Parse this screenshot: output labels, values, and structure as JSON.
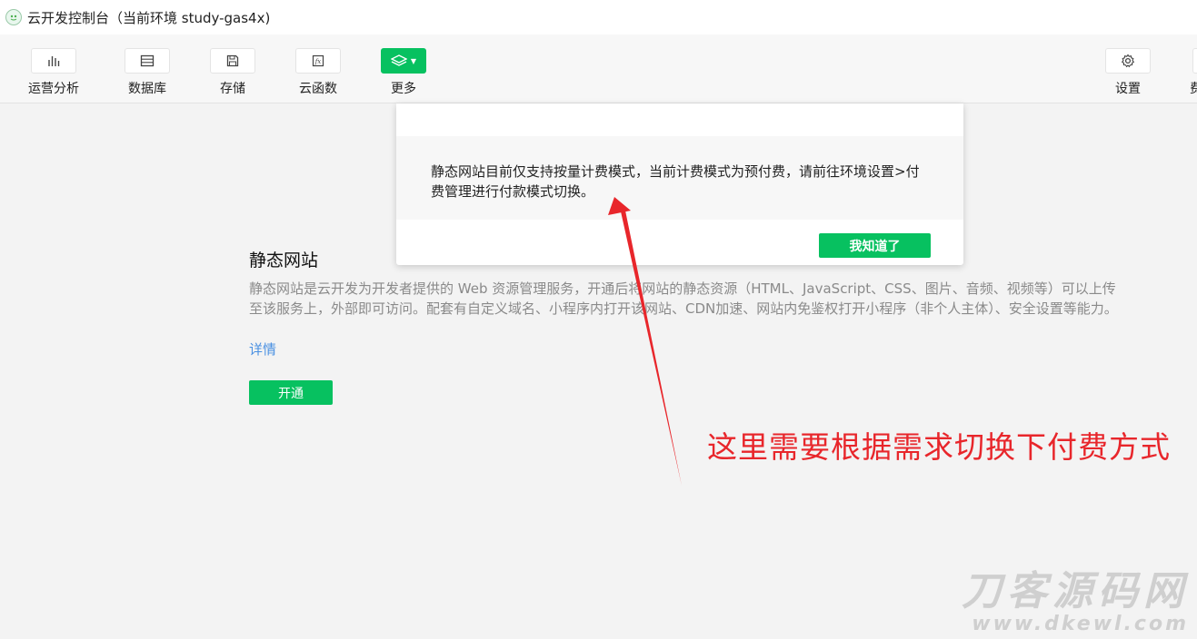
{
  "window": {
    "title": "云开发控制台（当前环境 study-gas4x)",
    "app_icon": "wechat-devtools-icon"
  },
  "toolbar": {
    "items": [
      {
        "label": "运营分析",
        "icon": "bar-chart-icon"
      },
      {
        "label": "数据库",
        "icon": "database-icon"
      },
      {
        "label": "存储",
        "icon": "save-icon"
      },
      {
        "label": "云函数",
        "icon": "function-icon"
      },
      {
        "label": "更多",
        "icon": "layers-icon"
      }
    ],
    "settings": {
      "label": "设置",
      "icon": "gear-icon"
    },
    "partial_label": "费",
    "accent": "#07c160"
  },
  "modal": {
    "message": "静态网站目前仅支持按量计费模式，当前计费模式为预付费，请前往环境设置>付费管理进行付款模式切换。",
    "ok_label": "我知道了"
  },
  "section": {
    "title": "静态网站",
    "description": "静态网站是云开发为开发者提供的 Web 资源管理服务，开通后将网站的静态资源（HTML、JavaScript、CSS、图片、音频、视频等）可以上传至该服务上，外部即可访问。配套有自定义域名、小程序内打开该网站、CDN加速、网站内免鉴权打开小程序（非个人主体）、安全设置等能力。",
    "detail_link": "详情",
    "open_button": "开通"
  },
  "annotation": {
    "text": "这里需要根据需求切换下付费方式",
    "color": "#e8262b"
  },
  "watermark": {
    "main": "刀客源码网",
    "sub": "www.dkewl.com"
  }
}
